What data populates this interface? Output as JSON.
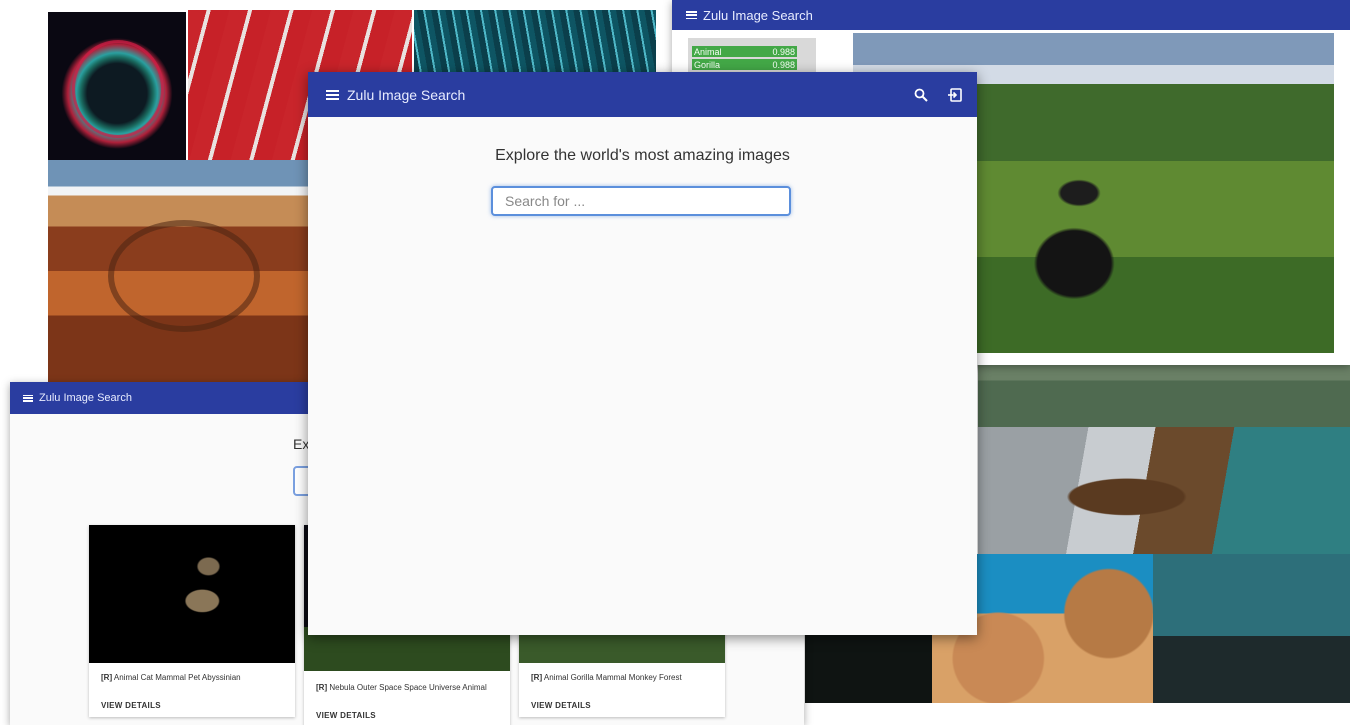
{
  "app": {
    "title": "Zulu Image Search"
  },
  "main": {
    "headline": "Explore the world's most amazing images",
    "search_placeholder": "Search for ...",
    "icons": {
      "search": "search-icon",
      "login": "login-icon",
      "menu": "menu-icon"
    }
  },
  "detail_window": {
    "tags": [
      {
        "label": "Animal",
        "score": "0.988"
      },
      {
        "label": "Gorilla",
        "score": "0.988"
      }
    ]
  },
  "results_window": {
    "headline_peek": "Ex",
    "cards": [
      {
        "prefix": "[R]",
        "caption": "Animal Cat Mammal Pet Abyssinian",
        "action": "VIEW DETAILS"
      },
      {
        "prefix": "[R]",
        "caption": "Nebula Outer Space Space Universe Animal",
        "action": "VIEW DETAILS"
      },
      {
        "prefix": "[R]",
        "caption": "Animal Gorilla Mammal Monkey Forest",
        "action": "VIEW DETAILS"
      }
    ]
  },
  "colors": {
    "appbar": "#2a3da0",
    "tag_green": "#43a847",
    "focus_blue": "#5b8fdc"
  }
}
